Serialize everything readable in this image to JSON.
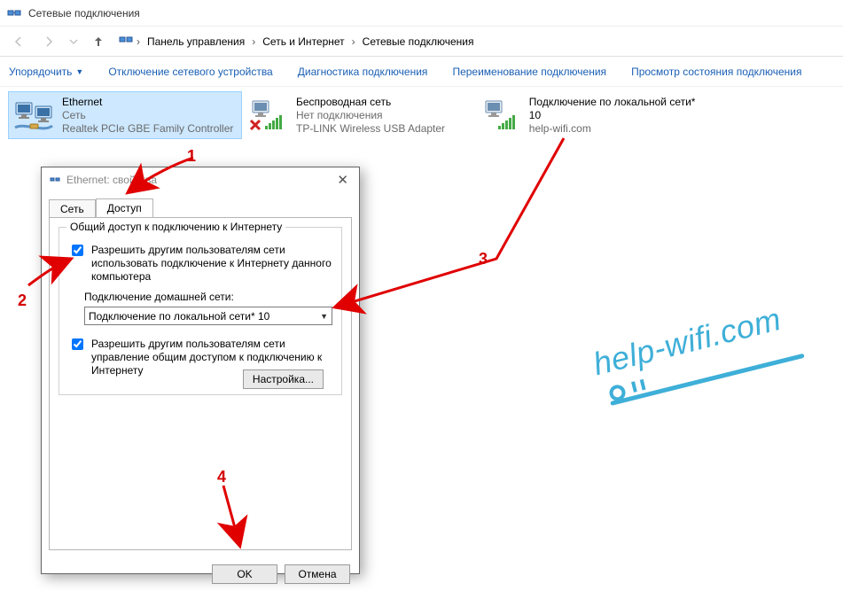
{
  "window": {
    "title": "Сетевые подключения"
  },
  "breadcrumb": {
    "items": [
      "Панель управления",
      "Сеть и Интернет",
      "Сетевые подключения"
    ]
  },
  "toolbar": {
    "organize": "Упорядочить",
    "disable": "Отключение сетевого устройства",
    "diagnose": "Диагностика подключения",
    "rename": "Переименование подключения",
    "status": "Просмотр состояния подключения"
  },
  "connections": [
    {
      "name": "Ethernet",
      "status": "Сеть",
      "device": "Realtek PCIe GBE Family Controller",
      "selected": true,
      "kind": "ethernet"
    },
    {
      "name": "Беспроводная сеть",
      "status": "Нет подключения",
      "device": "TP-LINK Wireless USB Adapter",
      "selected": false,
      "kind": "wifi-off"
    },
    {
      "name": "Подключение по локальной сети* 10",
      "status": "help-wifi.com",
      "device": "",
      "selected": false,
      "kind": "wifi-on"
    }
  ],
  "dialog": {
    "title": "Ethernet: свойства",
    "tabs": {
      "network": "Сеть",
      "sharing": "Доступ"
    },
    "group_legend": "Общий доступ к подключению к Интернету",
    "chk_allow_share": "Разрешить другим пользователям сети использовать подключение к Интернету данного компьютера",
    "home_net_label": "Подключение домашней сети:",
    "home_net_value": "Подключение по локальной сети* 10",
    "chk_allow_control": "Разрешить другим пользователям сети управление общим доступом к подключению к Интернету",
    "settings_btn": "Настройка...",
    "ok": "OK",
    "cancel": "Отмена"
  },
  "annotations": {
    "n1": "1",
    "n2": "2",
    "n3": "3",
    "n4": "4"
  },
  "watermark": "help-wifi.com"
}
